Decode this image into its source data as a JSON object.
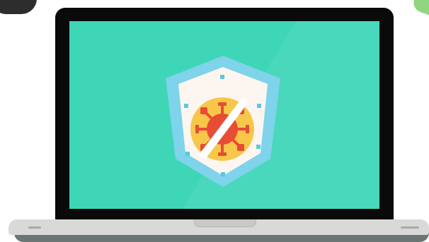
{
  "illustration": {
    "subject": "laptop-with-antivirus-shield",
    "colors": {
      "bezel": "#0a0a0a",
      "screen": "#3fd6b8",
      "shield_outer": "#7fd3ea",
      "shield_inner": "#fdf6f0",
      "circle": "#f7c74a",
      "virus": "#e74c35",
      "slash": "#ffffff",
      "dots": "#5bc7e3",
      "base": "#d9dad8"
    },
    "icons": [
      "shield-icon",
      "virus-icon",
      "prohibition-icon"
    ]
  }
}
